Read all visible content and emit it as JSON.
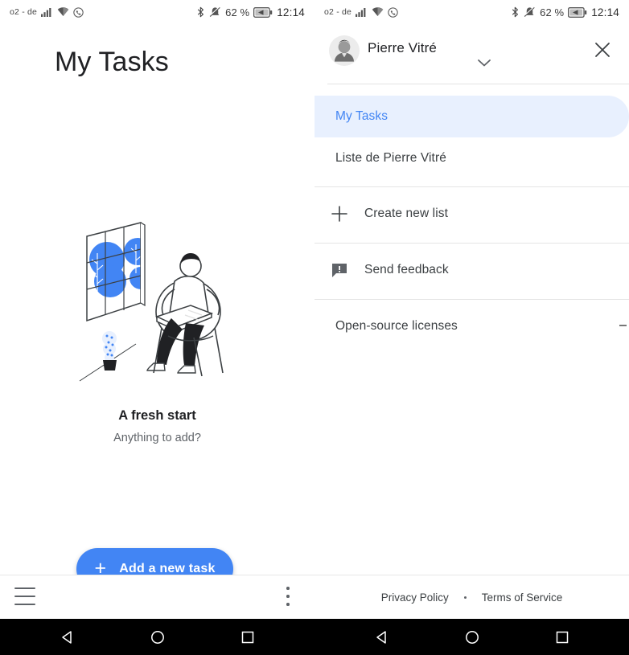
{
  "status_bar": {
    "carrier": "o2 - de",
    "battery_percent": "62 %",
    "clock": "12:14",
    "icons": [
      "signal-icon",
      "wifi-icon",
      "whatsapp-icon",
      "bluetooth-icon",
      "vibrate-off-icon",
      "battery-icon"
    ]
  },
  "left_panel": {
    "title": "My Tasks",
    "empty_state": {
      "illustration": "person-reading-in-chair-illustration",
      "headline": "A fresh start",
      "subtext": "Anything to add?"
    },
    "fab": {
      "label": "Add a new task",
      "icon": "plus-icon",
      "color": "#4285f4"
    },
    "bottom_bar": {
      "menu_icon": "hamburger-menu-icon",
      "overflow_icon": "more-vertical-icon"
    }
  },
  "drawer": {
    "account": {
      "name": "Pierre Vitré",
      "avatar": "user-avatar",
      "expand_icon": "chevron-down-icon"
    },
    "close_icon": "close-icon",
    "lists": [
      {
        "label": "My Tasks",
        "selected": true
      },
      {
        "label": "Liste de Pierre Vitré",
        "selected": false
      }
    ],
    "actions": [
      {
        "label": "Create new list",
        "icon": "plus-icon"
      },
      {
        "label": "Send feedback",
        "icon": "feedback-icon"
      },
      {
        "label": "Open-source licenses",
        "icon": null
      }
    ],
    "footer": {
      "privacy": "Privacy Policy",
      "separator": "•",
      "terms": "Terms of Service"
    },
    "accent_color": "#4285f4",
    "selected_bg": "#e8f0fe"
  },
  "nav_bar": {
    "back": "back-triangle-icon",
    "home": "home-circle-icon",
    "recents": "recents-square-icon"
  }
}
